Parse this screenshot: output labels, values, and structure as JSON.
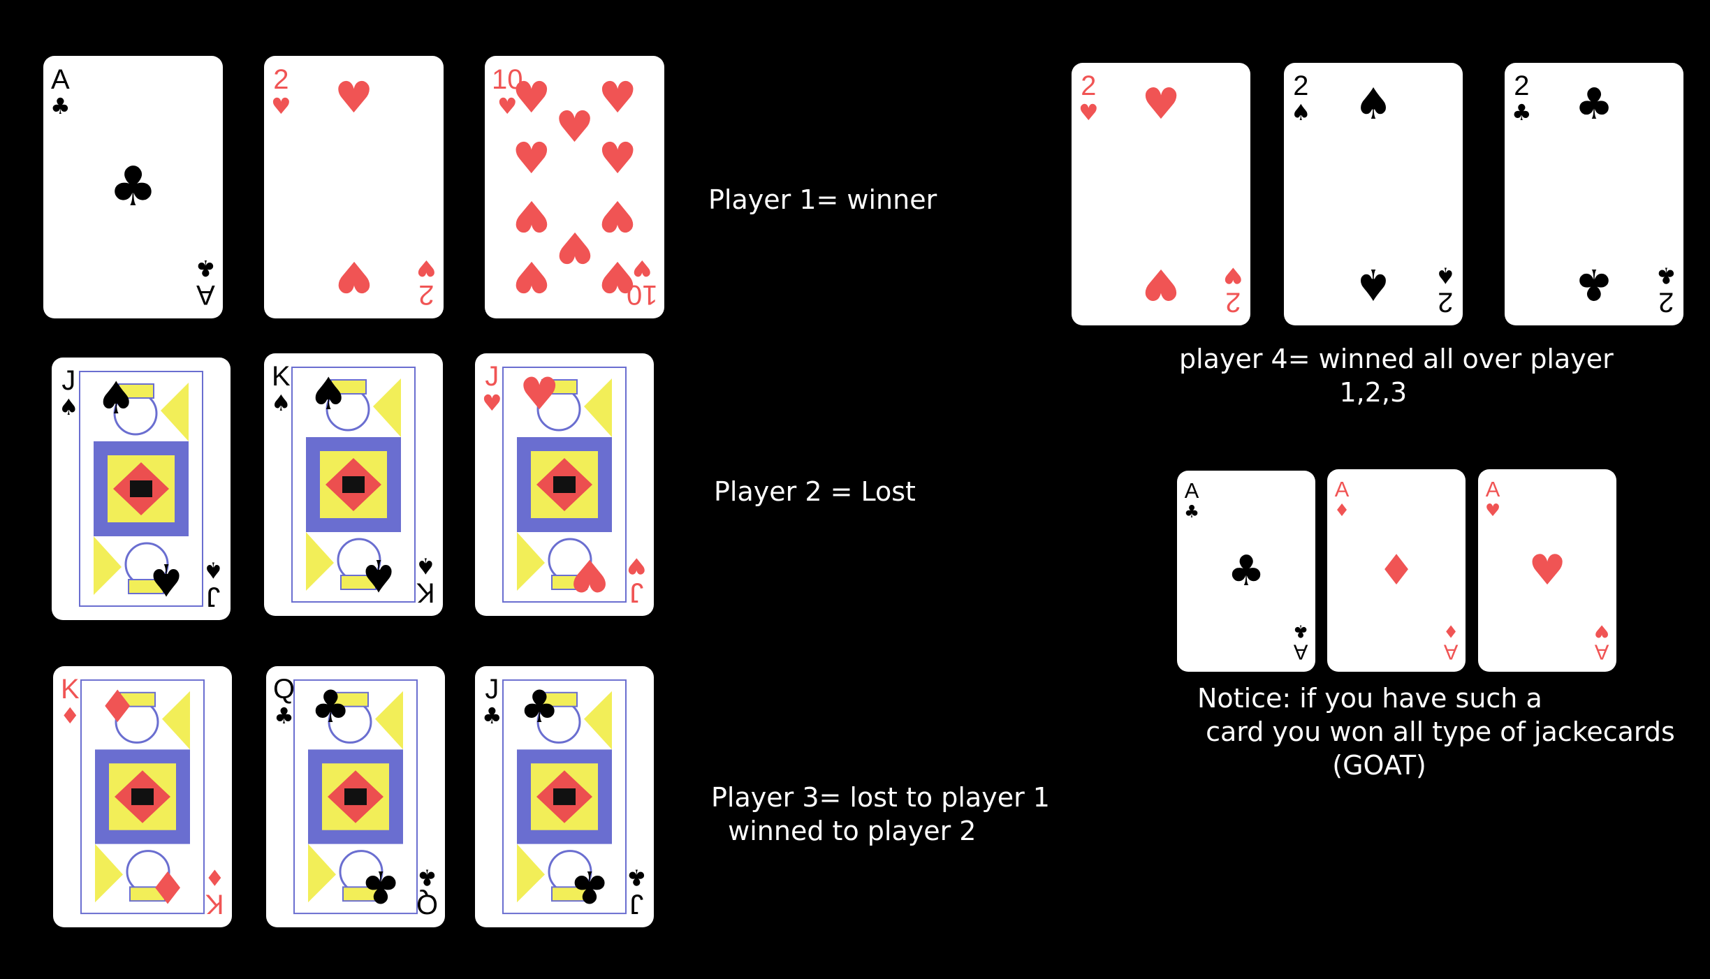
{
  "colors": {
    "background": "#000000",
    "red_suit": "#f05454",
    "black_suit": "#000000",
    "face_blue": "#6a6ed0",
    "face_yellow": "#f2ee58",
    "face_red": "#ec4f4f"
  },
  "cards": {
    "p1_ace_clubs": {
      "rank": "A",
      "suit": "♣",
      "color": "black"
    },
    "p1_two_hearts": {
      "rank": "2",
      "suit": "♥",
      "color": "red"
    },
    "p1_ten_hearts": {
      "rank": "10",
      "suit": "♥",
      "color": "red"
    },
    "p2_jack_spades": {
      "rank": "J",
      "suit": "♠",
      "color": "black"
    },
    "p2_king_spades": {
      "rank": "K",
      "suit": "♠",
      "color": "black"
    },
    "p2_jack_hearts": {
      "rank": "J",
      "suit": "♥",
      "color": "red"
    },
    "p3_king_diamonds": {
      "rank": "K",
      "suit": "♦",
      "color": "red"
    },
    "p3_queen_clubs": {
      "rank": "Q",
      "suit": "♣",
      "color": "black"
    },
    "p3_jack_clubs": {
      "rank": "J",
      "suit": "♣",
      "color": "black"
    },
    "p4_two_hearts": {
      "rank": "2",
      "suit": "♥",
      "color": "red"
    },
    "p4_two_spades": {
      "rank": "2",
      "suit": "♠",
      "color": "black"
    },
    "p4_two_clubs": {
      "rank": "2",
      "suit": "♣",
      "color": "black"
    },
    "goat_ace_clubs": {
      "rank": "A",
      "suit": "♣",
      "color": "black"
    },
    "goat_ace_diamonds": {
      "rank": "A",
      "suit": "♦",
      "color": "red"
    },
    "goat_ace_hearts": {
      "rank": "A",
      "suit": "♥",
      "color": "red"
    }
  },
  "labels": {
    "player1": "Player 1= winner",
    "player2": "Player 2 = Lost",
    "player3": "Player 3= lost to player 1\n  winned to player 2",
    "player4": "player 4= winned all over player\n                   1,2,3",
    "notice": "Notice: if you have such a\n card you won all type of jackecards\n                (GOAT)"
  }
}
